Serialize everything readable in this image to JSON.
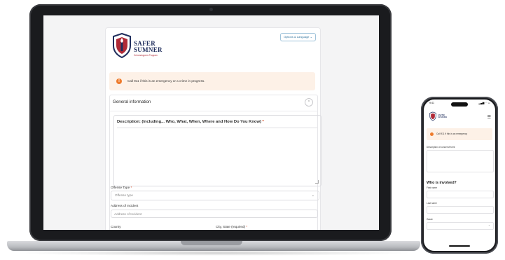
{
  "brand": {
    "title_line1": "SAFER",
    "title_line2": "SUMNER",
    "tagline": "Crimestoppers Program"
  },
  "header": {
    "options_button": "Options & Language ⌄"
  },
  "alert": {
    "text": "Call 911 if this is an emergency or a crime in progress.",
    "icon": "!"
  },
  "section": {
    "title": "General information",
    "collapse_icon": "⌃"
  },
  "description": {
    "label": "Description: (Including... Who, What, When, Where and How Do You Know)",
    "required_mark": "*"
  },
  "offense_type": {
    "label": "Offense Type",
    "required_mark": "*",
    "placeholder": "Offense type"
  },
  "address": {
    "label": "Address of Incident",
    "placeholder": "Address of Incident"
  },
  "county": {
    "label": "County"
  },
  "city_state": {
    "label": "City, State (required)",
    "required_mark": "*"
  },
  "phone": {
    "time": "9:41",
    "status": "▂▄▆ ◠ ▭",
    "alert_text": "Call 911 if this is an emergency",
    "description_label": "Description of concern/event",
    "involved_heading": "Who is involved?",
    "first_name_label": "First name",
    "last_name_label": "Last name",
    "grade_label": "Grade",
    "menu_icon": "☰",
    "chevron": "⌄"
  },
  "colors": {
    "brand_navy": "#1f2d5c",
    "brand_red": "#b02a37",
    "alert_bg": "#fdf1e7",
    "alert_icon": "#ee7b2c",
    "link_blue": "#2a6f9b"
  }
}
